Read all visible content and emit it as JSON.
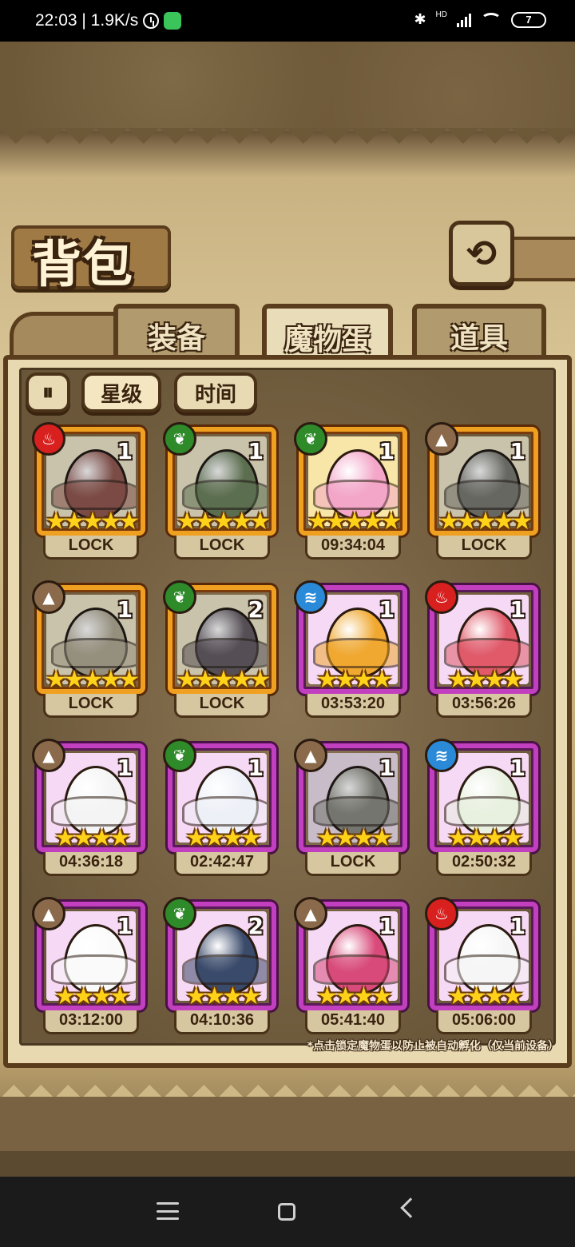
{
  "status_bar": {
    "time_speed": "22:03 | 1.9K/s",
    "signal_label": "HD",
    "battery": "7"
  },
  "screen": {
    "title": "背包",
    "back_icon": "back-arrow-icon",
    "tabs": [
      {
        "label": "装备",
        "active": false
      },
      {
        "label": "魔物蛋",
        "active": true
      },
      {
        "label": "道具",
        "active": false
      }
    ],
    "filters": {
      "toggle_icon": "sort-toggle-icon",
      "star_label": "星级",
      "time_label": "时间"
    },
    "eggs": [
      {
        "element": "fire",
        "count": "1",
        "stars": "★★★★★",
        "label": "LOCK",
        "rarity": "legend",
        "locked": true,
        "color": "#c84a3a"
      },
      {
        "element": "leaf",
        "count": "1",
        "stars": "★★★★★",
        "label": "LOCK",
        "rarity": "legend",
        "locked": true,
        "color": "#5a8a3a"
      },
      {
        "element": "leaf",
        "count": "1",
        "stars": "★★★★★",
        "label": "09:34:04",
        "rarity": "legend",
        "locked": false,
        "color": "#f3a6c8"
      },
      {
        "element": "rock",
        "count": "1",
        "stars": "★★★★★",
        "label": "LOCK",
        "rarity": "legend",
        "locked": true,
        "color": "#7a7a6a"
      },
      {
        "element": "rock",
        "count": "1",
        "stars": "★★★★★",
        "label": "LOCK",
        "rarity": "legend",
        "locked": true,
        "color": "#b8a87a"
      },
      {
        "element": "leaf",
        "count": "2",
        "stars": "★★★★★",
        "label": "LOCK",
        "rarity": "legend",
        "locked": true,
        "color": "#6a5a6a"
      },
      {
        "element": "water",
        "count": "1",
        "stars": "★★★★",
        "label": "03:53:20",
        "rarity": "epic",
        "locked": false,
        "color": "#f0a830"
      },
      {
        "element": "fire",
        "count": "1",
        "stars": "★★★★",
        "label": "03:56:26",
        "rarity": "epic",
        "locked": false,
        "color": "#e05a6a"
      },
      {
        "element": "rock",
        "count": "1",
        "stars": "★★★★",
        "label": "04:36:18",
        "rarity": "epic",
        "locked": false,
        "color": "#f4f4f4"
      },
      {
        "element": "leaf",
        "count": "1",
        "stars": "★★★★",
        "label": "02:42:47",
        "rarity": "epic",
        "locked": false,
        "color": "#eef0f8"
      },
      {
        "element": "rock",
        "count": "1",
        "stars": "★★★★",
        "label": "LOCK",
        "rarity": "epic",
        "locked": true,
        "color": "#8a8a7a"
      },
      {
        "element": "water",
        "count": "1",
        "stars": "★★★★",
        "label": "02:50:32",
        "rarity": "epic",
        "locked": false,
        "color": "#e8f0e0"
      },
      {
        "element": "rock",
        "count": "1",
        "stars": "★★★★",
        "label": "03:12:00",
        "rarity": "epic",
        "locked": false,
        "color": "#fafafa"
      },
      {
        "element": "leaf",
        "count": "2",
        "stars": "★★★★",
        "label": "04:10:36",
        "rarity": "epic",
        "locked": false,
        "color": "#3a4a6a"
      },
      {
        "element": "rock",
        "count": "1",
        "stars": "★★★★",
        "label": "05:41:40",
        "rarity": "epic",
        "locked": false,
        "color": "#d84a7a"
      },
      {
        "element": "fire",
        "count": "1",
        "stars": "★★★★",
        "label": "05:06:00",
        "rarity": "epic",
        "locked": false,
        "color": "#f6f6f6"
      }
    ],
    "footnote": "*点击锁定魔物蛋以防止被自动孵化（仅当前设备）"
  },
  "navbar": {
    "menu_icon": "menu-icon",
    "home_icon": "home-icon",
    "back_icon": "back-icon"
  }
}
